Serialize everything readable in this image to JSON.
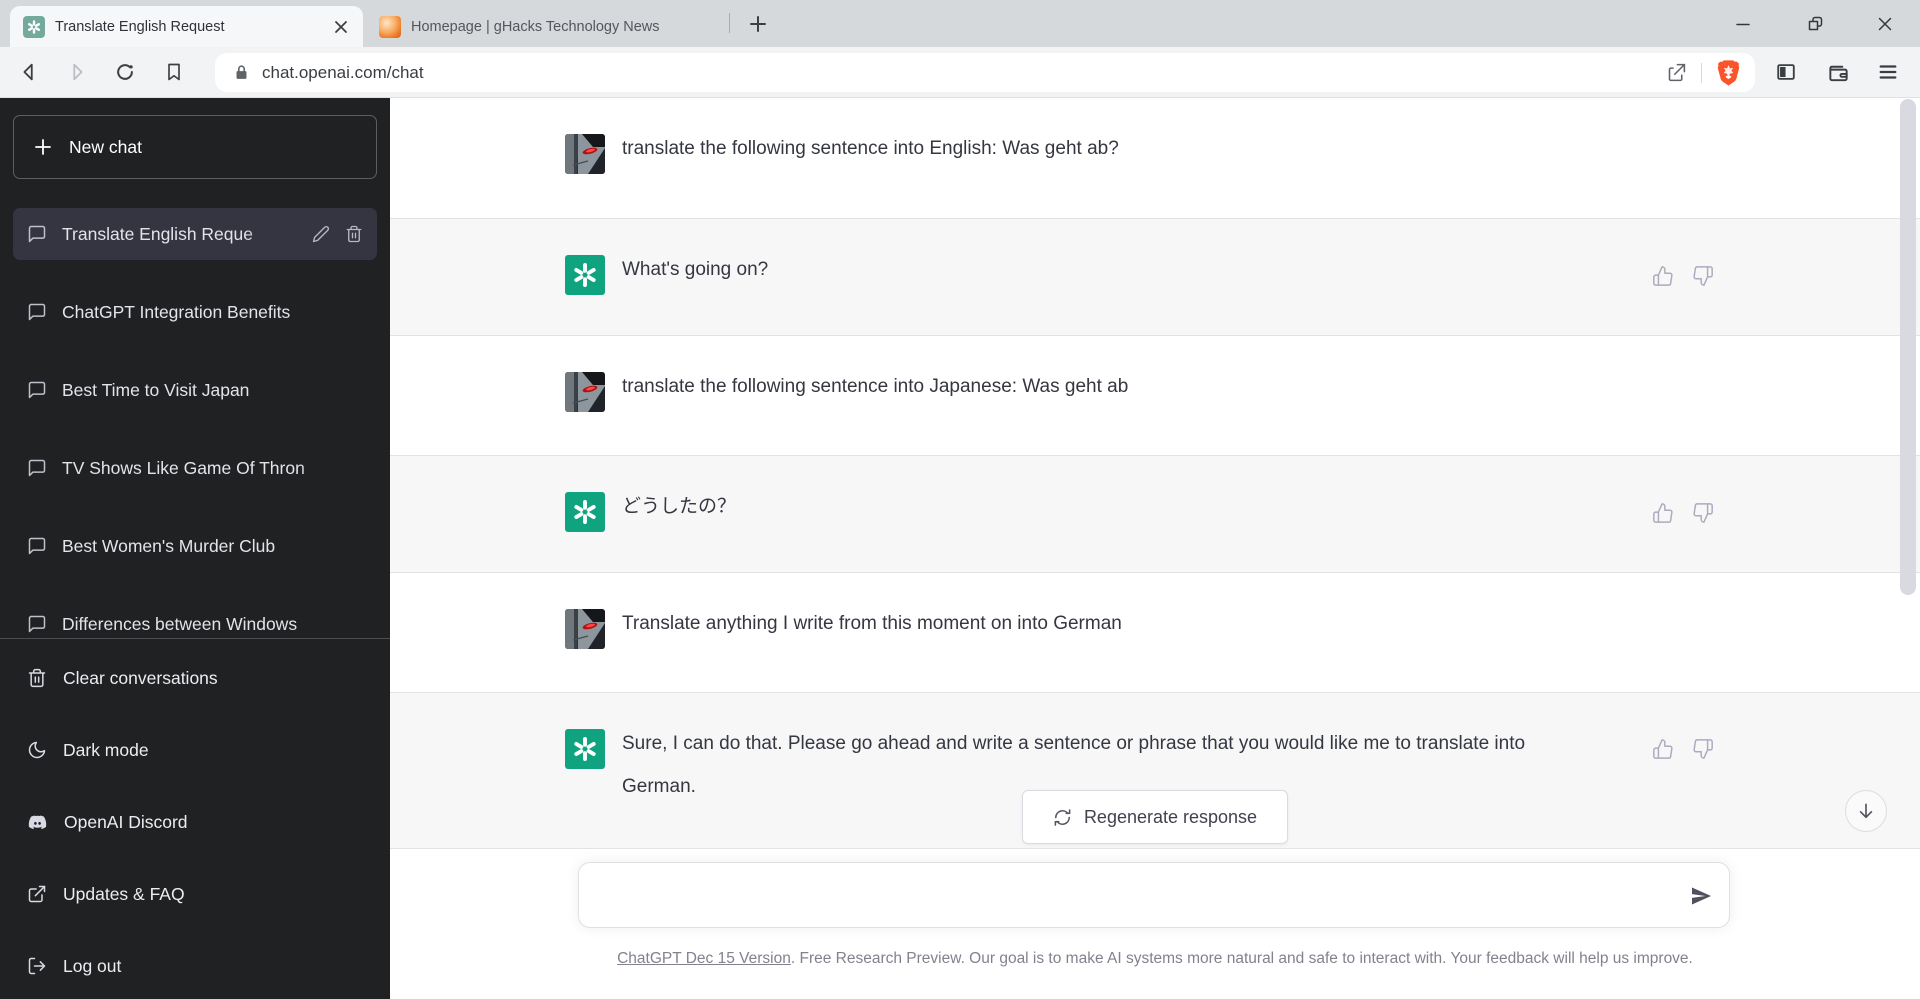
{
  "browser": {
    "tabs": [
      {
        "title": "Translate English Request",
        "active": true
      },
      {
        "title": "Homepage | gHacks Technology News",
        "active": false
      }
    ],
    "address_url": "chat.openai.com/chat"
  },
  "sidebar": {
    "new_chat": "New chat",
    "conversations": [
      {
        "title": "Translate English Reque",
        "active": true
      },
      {
        "title": "ChatGPT Integration Benefits",
        "active": false
      },
      {
        "title": "Best Time to Visit Japan",
        "active": false
      },
      {
        "title": "TV Shows Like Game Of Thron",
        "active": false
      },
      {
        "title": "Best Women's Murder Club",
        "active": false
      },
      {
        "title": "Differences between Windows",
        "active": false
      }
    ],
    "menu": [
      {
        "label": "Clear conversations",
        "icon": "trash-icon"
      },
      {
        "label": "Dark mode",
        "icon": "moon-icon"
      },
      {
        "label": "OpenAI Discord",
        "icon": "discord-icon"
      },
      {
        "label": "Updates & FAQ",
        "icon": "external-link-icon"
      },
      {
        "label": "Log out",
        "icon": "logout-icon"
      }
    ]
  },
  "chat": {
    "messages": [
      {
        "role": "user",
        "text": "translate the following sentence into English: Was geht ab?"
      },
      {
        "role": "assistant",
        "text": "What's going on?"
      },
      {
        "role": "user",
        "text": "translate the following sentence into Japanese: Was geht ab"
      },
      {
        "role": "assistant",
        "text": "どうしたの？"
      },
      {
        "role": "user",
        "text": "Translate anything I write from this moment on into German"
      },
      {
        "role": "assistant",
        "text": "Sure, I can do that. Please go ahead and write a sentence or phrase that you would like me to translate into German."
      }
    ],
    "regenerate_label": "Regenerate response",
    "composer_value": "",
    "footer_link": "ChatGPT Dec 15 Version",
    "footer_text": ". Free Research Preview. Our goal is to make AI systems more natural and safe to interact with. Your feedback will help us improve."
  },
  "icons": {
    "new-chat-plus": "+",
    "new-tab-plus": "+",
    "tab-close": "×",
    "window-minimize": "–",
    "window-restore": "❐",
    "window-close": "×",
    "back": "◁",
    "forward": "▷",
    "reload": "↻",
    "bookmark": "⚑",
    "lock": "🔒",
    "share": "↗",
    "brave-shield": "lion",
    "thumbs-up": "👍",
    "thumbs-down": "👎",
    "regenerate": "⟳",
    "send": "➤",
    "scroll-down": "↓"
  },
  "colors": {
    "sidebar_bg": "#202123",
    "sidebar_active_bg": "#343541",
    "assistant_row_bg": "#f7f7f8",
    "chatgpt_green": "#10a37f",
    "tab_favicon_green": "#74aa9c",
    "brave_orange": "#fb542b",
    "text_primary": "#353740",
    "muted_icon": "#ababbe"
  }
}
